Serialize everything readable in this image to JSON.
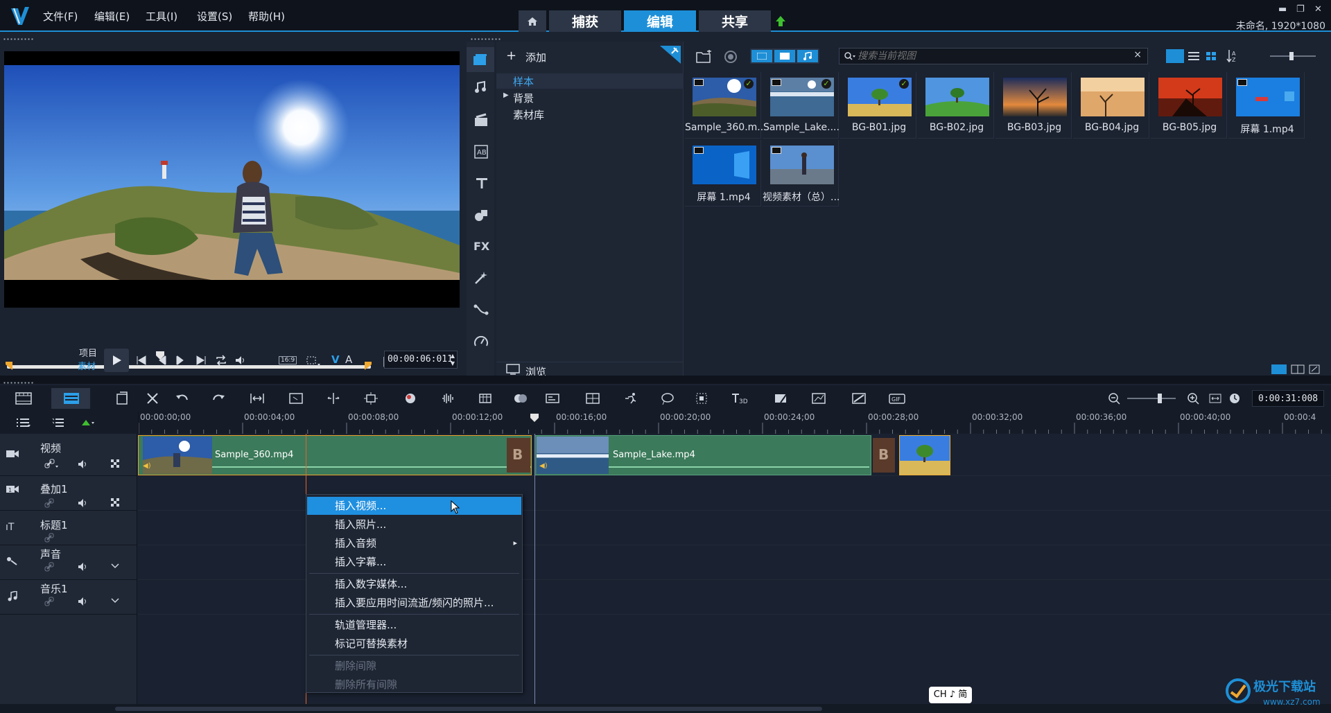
{
  "menu": [
    "文件(F)",
    "编辑(E)",
    "工具(I)",
    "设置(S)",
    "帮助(H)"
  ],
  "tabs": {
    "capture": "捕获",
    "edit": "编辑",
    "share": "共享"
  },
  "window": {
    "minimize": "▬",
    "restore": "❐",
    "close": "✕"
  },
  "project_info": "未命名, 1920*1080",
  "preview": {
    "project_label": "项目",
    "clip_label": "素材",
    "aspect": "16:9",
    "v_label": "V",
    "a_label": "A",
    "timecode": "00:00:06:011"
  },
  "library": {
    "add_label": "添加",
    "tree": {
      "sample": "样本",
      "background": "背景",
      "library": "素材库"
    },
    "browse_label": "浏览",
    "search_placeholder": "搜索当前视图",
    "clear_search": "×",
    "thumbnails": [
      {
        "name": "Sample_360.m...",
        "checked": true,
        "video": true
      },
      {
        "name": "Sample_Lake....",
        "checked": true,
        "video": true
      },
      {
        "name": "BG-B01.jpg",
        "checked": true,
        "video": false
      },
      {
        "name": "BG-B02.jpg",
        "checked": false,
        "video": false
      },
      {
        "name": "BG-B03.jpg",
        "checked": false,
        "video": false
      },
      {
        "name": "BG-B04.jpg",
        "checked": false,
        "video": false
      },
      {
        "name": "BG-B05.jpg",
        "checked": false,
        "video": false
      },
      {
        "name": "屏幕 1.mp4",
        "checked": false,
        "video": true
      },
      {
        "name": "屏幕 1.mp4",
        "checked": false,
        "video": true
      },
      {
        "name": "视频素材（总）....",
        "checked": false,
        "video": true
      }
    ],
    "side_fx": "FX"
  },
  "timeline": {
    "total_time": "0:00:31:008",
    "ruler": [
      "00:00:00;00",
      "00:00:04;00",
      "00:00:08;00",
      "00:00:12;00",
      "00:00:16;00",
      "00:00:20;00",
      "00:00:24;00",
      "00:00:28;00",
      "00:00:32;00",
      "00:00:36;00",
      "00:00:40;00",
      "00:00:4"
    ],
    "tracks": [
      "视频",
      "叠加1",
      "标题1",
      "声音",
      "音乐1"
    ],
    "clips": {
      "clip1": "Sample_360.mp4",
      "clip2": "Sample_Lake.mp4"
    },
    "tools": {
      "title_3d": "3D",
      "gif": "GIF"
    }
  },
  "context_menu": {
    "items": [
      "插入视频...",
      "插入照片...",
      "插入音频",
      "插入字幕...",
      "插入数字媒体...",
      "插入要应用时间流逝/频闪的照片...",
      "轨道管理器...",
      "标记可替换素材",
      "删除间隙",
      "删除所有间隙"
    ],
    "submenu_arrow": "▸"
  },
  "ime": "CH ♪ 简",
  "watermark": {
    "title": "极光下载站",
    "url": "www.xz7.com"
  }
}
